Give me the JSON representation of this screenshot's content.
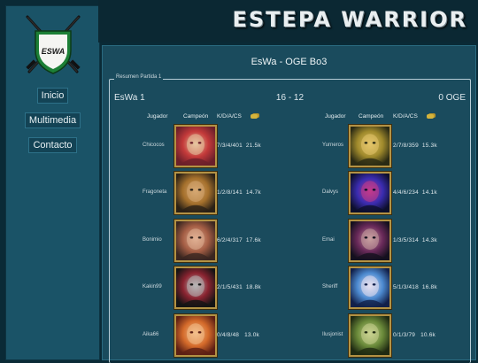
{
  "app": {
    "brand": "ESTEPA WARRIOR",
    "logo_text": "ESWA"
  },
  "nav": {
    "items": [
      {
        "label": "Inicio"
      },
      {
        "label": "Multimedia"
      },
      {
        "label": "Contacto"
      }
    ]
  },
  "match": {
    "title": "EsWa - OGE Bo3",
    "fieldset_legend": "Resumen Partida 1",
    "team_a": "EsWa 1",
    "score": "16 - 12",
    "team_b": "0 OGE"
  },
  "columns": {
    "player": "Jugador",
    "champion": "Campeón",
    "kdacs": "K/D/A/CS",
    "gold_icon": "gold-coins-icon"
  },
  "team_a_rows": [
    {
      "player": "Chicocos",
      "stats": "7/3/4/401  21.5k",
      "champion_colors": [
        "#6b1f2a",
        "#c43a3a",
        "#e6c6a0"
      ]
    },
    {
      "player": "Fragoneta",
      "stats": "1/2/8/141  14.7k",
      "champion_colors": [
        "#2a2116",
        "#a5702c",
        "#d6a873"
      ]
    },
    {
      "player": "Bonimio",
      "stats": "6/2/4/317  17.6k",
      "champion_colors": [
        "#3a2620",
        "#a55e45",
        "#e0b093"
      ]
    },
    {
      "player": "Kakin99",
      "stats": "2/1/5/431  18.8k",
      "champion_colors": [
        "#141414",
        "#8a2330",
        "#b7b7b7"
      ]
    },
    {
      "player": "Aika66",
      "stats": "0/4/8/48   13.0k",
      "champion_colors": [
        "#5c1f14",
        "#d46a2a",
        "#f2c08d"
      ]
    }
  ],
  "team_b_rows": [
    {
      "player": "Yurneros",
      "stats": "2/7/8/359  15.3k",
      "champion_colors": [
        "#2a2a14",
        "#a08a2c",
        "#e3c46a"
      ]
    },
    {
      "player": "Dalvys",
      "stats": "4/4/6/234  14.1k",
      "champion_colors": [
        "#0d0f2c",
        "#3a2cb0",
        "#c43a8a"
      ]
    },
    {
      "player": "Emai",
      "stats": "1/3/5/314  14.3k",
      "champion_colors": [
        "#14101e",
        "#6a2a5a",
        "#c8a0a0"
      ]
    },
    {
      "player": "Sheriff",
      "stats": "5/1/3/418  16.8k",
      "champion_colors": [
        "#12204a",
        "#4c8ad0",
        "#e6e0f0"
      ]
    },
    {
      "player": "Ilusjonist",
      "stats": "0/1/3/79   10.6k",
      "champion_colors": [
        "#1f2a12",
        "#6a8a3a",
        "#c9d190"
      ]
    }
  ]
}
